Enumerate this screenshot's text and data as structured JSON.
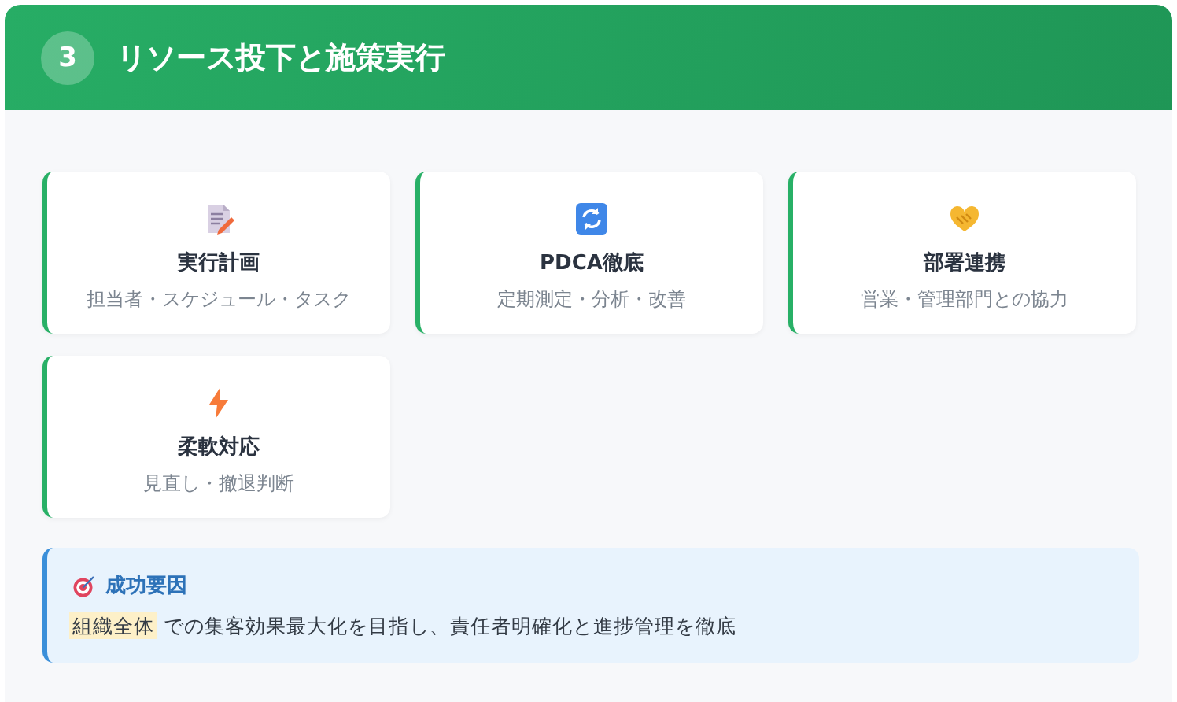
{
  "header": {
    "number": "3",
    "title": "リソース投下と施策実行"
  },
  "cards": [
    {
      "title": "実行計画",
      "subtitle": "担当者・スケジュール・タスク"
    },
    {
      "title": "PDCA徹底",
      "subtitle": "定期測定・分析・改善"
    },
    {
      "title": "部署連携",
      "subtitle": "営業・管理部門との協力"
    },
    {
      "title": "柔軟対応",
      "subtitle": "見直し・撤退判断"
    }
  ],
  "callout": {
    "title": "成功要因",
    "highlight": "組織全体",
    "text": "での集客効果最大化を目指し、責任者明確化と進捗管理を徹底"
  }
}
